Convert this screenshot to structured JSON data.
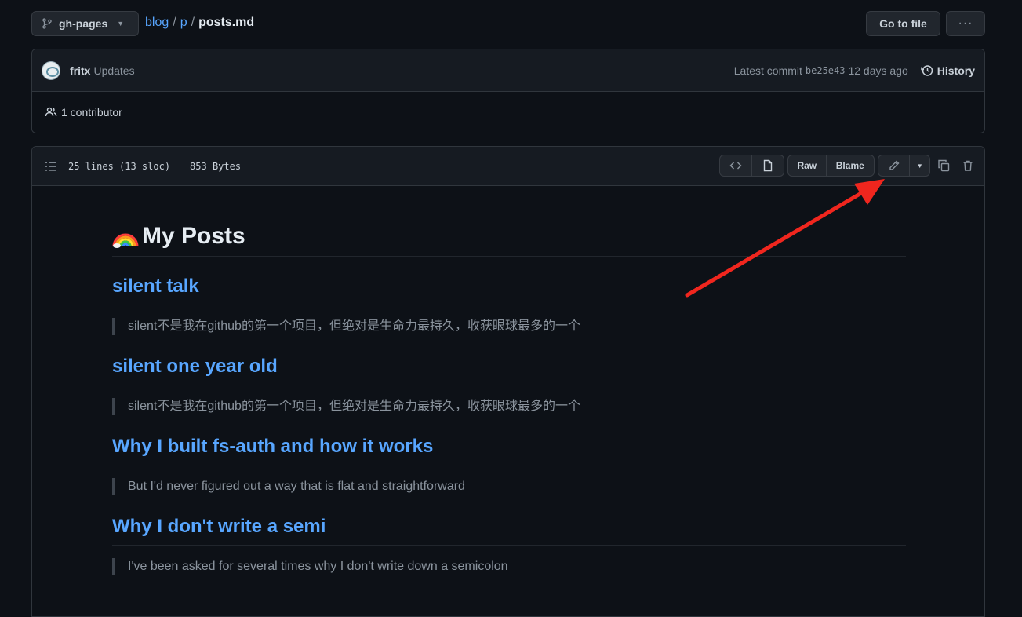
{
  "topbar": {
    "branch": "gh-pages",
    "breadcrumb": {
      "repo": "blog",
      "dir": "p",
      "sep": "/",
      "file": "posts.md"
    },
    "go_to_file": "Go to file",
    "more": "···"
  },
  "commit": {
    "author": "fritx",
    "message": "Updates",
    "latest_label": "Latest commit",
    "sha": "be25e43",
    "age": "12 days ago",
    "history_label": "History",
    "contributors": "1 contributor"
  },
  "file": {
    "lines": "25 lines (13 sloc)",
    "size": "853 Bytes",
    "raw_label": "Raw",
    "blame_label": "Blame"
  },
  "content": {
    "title": "My Posts",
    "posts": [
      {
        "title": "silent talk",
        "quote": "silent不是我在github的第一个项目，但绝对是生命力最持久，收获眼球最多的一个"
      },
      {
        "title": "silent one year old",
        "quote": "silent不是我在github的第一个项目，但绝对是生命力最持久，收获眼球最多的一个"
      },
      {
        "title": "Why I built fs-auth and how it works",
        "quote": "But I'd never figured out a way that is flat and straightforward"
      },
      {
        "title": "Why I don't write a semi",
        "quote": "I've been asked for several times why I don't write down a semicolon"
      }
    ]
  },
  "icons": [
    "branch-icon",
    "history-icon",
    "people-icon",
    "list-icon",
    "code-icon",
    "file-icon",
    "pencil-icon",
    "copy-icon",
    "trash-icon",
    "rainbow-icon"
  ],
  "colors": {
    "link": "#58a6ff",
    "background": "#0d1117",
    "annotation_arrow": "#f0261e"
  }
}
